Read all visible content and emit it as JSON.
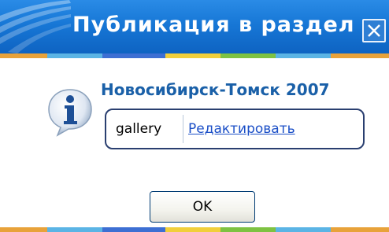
{
  "window": {
    "title": "Публикация в раздел",
    "close_icon": "close-icon"
  },
  "message": {
    "icon": "info-icon",
    "heading": "Новосибирск-Томск 2007"
  },
  "tag": {
    "name": "gallery",
    "edit_link": "Редактировать"
  },
  "buttons": {
    "ok_label": "OK"
  },
  "colors": {
    "title_bar": "#1777d6",
    "heading_text": "#1a60a8",
    "link": "#1b4fc7",
    "box_border": "#2a3f70",
    "stripe": [
      "#e8a23a",
      "#5bb4e5",
      "#f1cf3b",
      "#7ec242",
      "#3d6fd3"
    ]
  }
}
